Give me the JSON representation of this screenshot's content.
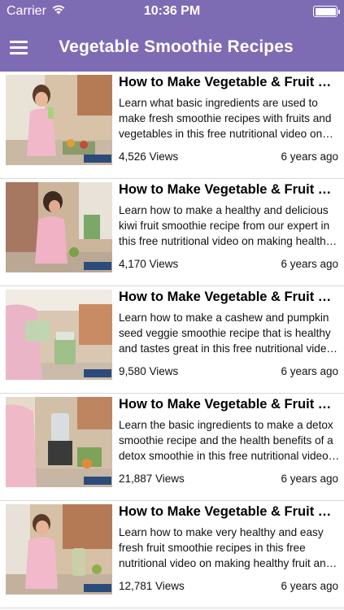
{
  "status_bar": {
    "carrier": "Carrier",
    "time": "10:36 PM",
    "icons": [
      "wifi-icon",
      "battery-icon"
    ]
  },
  "nav_bar": {
    "title": "Vegetable Smoothie Recipes",
    "menu_icon": "hamburger-menu-icon",
    "color": "#7d6bb4"
  },
  "videos": [
    {
      "title": "How to Make Vegetable & Fruit Smoothie",
      "description": "Learn what basic ingredients are used to make fresh smoothie recipes with fruits and vegetables in this free nutritional video on making healthy smoothies.",
      "views": "4,526 Views",
      "age": "6 years ago"
    },
    {
      "title": "How to Make Vegetable & Fruit Smoothie",
      "description": "Learn how to make a healthy and delicious kiwi fruit smoothie recipe from our expert in this free nutritional video on making healthy smoothies.",
      "views": "4,170 Views",
      "age": "6 years ago"
    },
    {
      "title": "How to Make Vegetable & Fruit Smoothie",
      "description": "Learn how to make a cashew and pumpkin seed veggie smoothie recipe that is healthy and tastes great in this free nutritional video on making smoothies.",
      "views": "9,580 Views",
      "age": "6 years ago"
    },
    {
      "title": "How to Make Vegetable & Fruit Smoothie",
      "description": "Learn the basic ingredients to make a detox smoothie recipe and the health benefits of a detox smoothie in this free nutritional video on making smoothies.",
      "views": "21,887 Views",
      "age": "6 years ago"
    },
    {
      "title": "How to Make Vegetable & Fruit Smoothie",
      "description": "Learn how to make very healthy and easy fresh fruit smoothie recipes in this free nutritional video on making healthy fruit and vegetable smoothies.",
      "views": "12,781 Views",
      "age": "6 years ago"
    }
  ]
}
